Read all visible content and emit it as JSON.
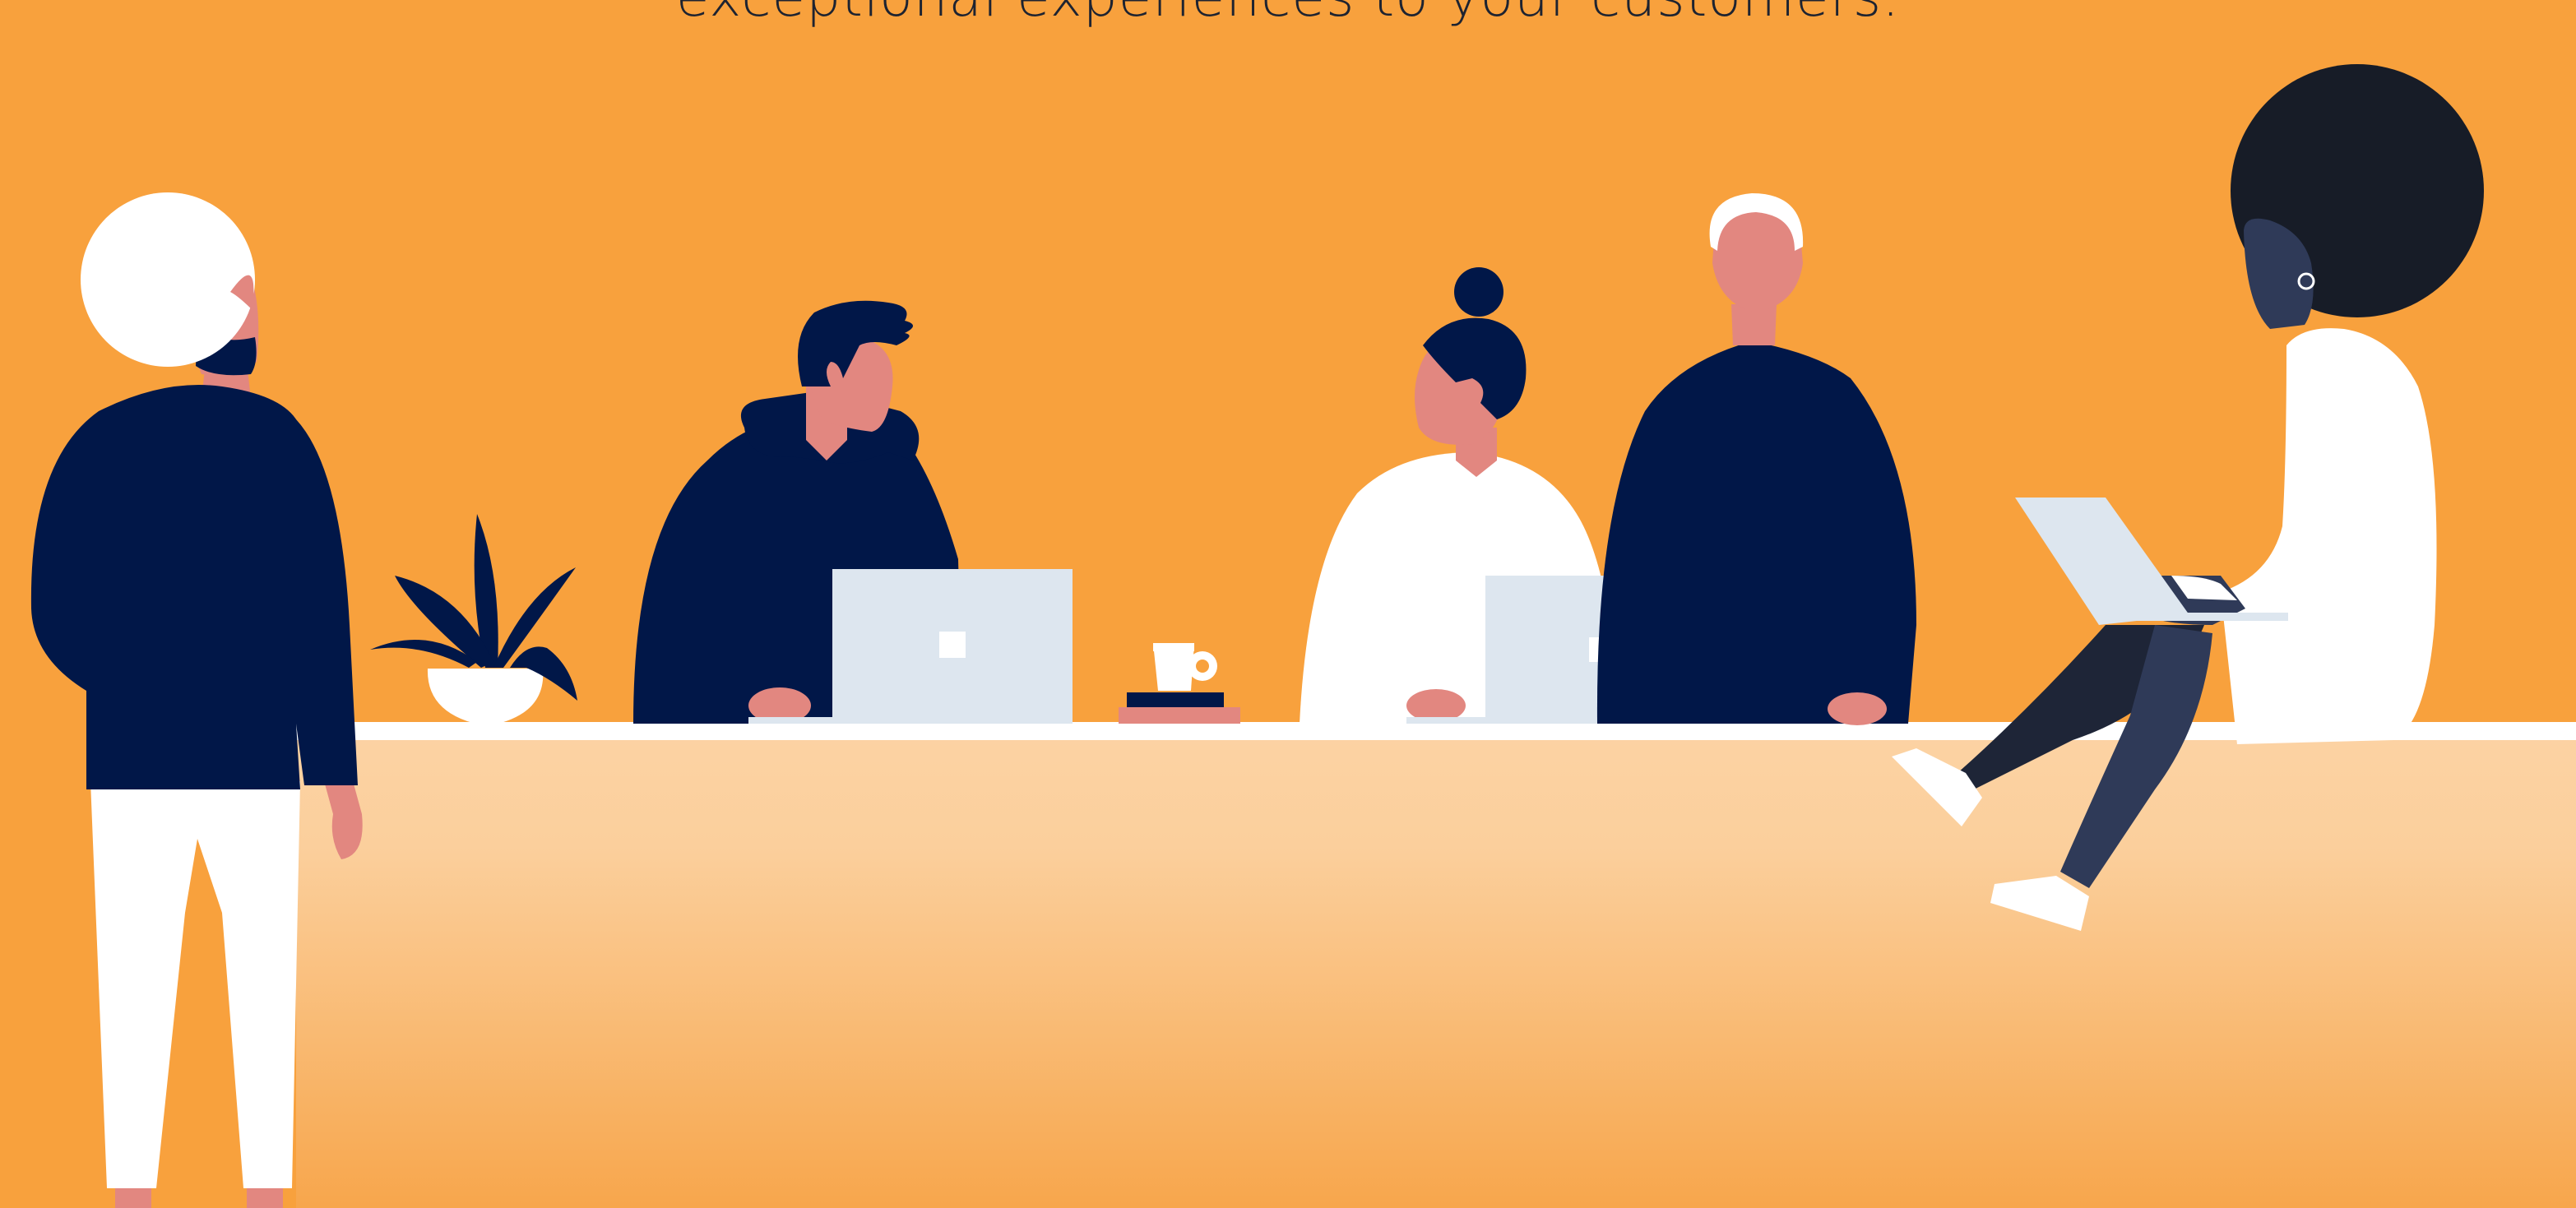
{
  "caption": {
    "text": "exceptional experiences to your customers."
  },
  "colors": {
    "background": "#F8A13D",
    "counter_top": "#FCD3A4",
    "counter_bottom": "#F7A54A",
    "navy": "#011748",
    "skin": "#E28780",
    "white": "#FFFFFF",
    "laptop": "#DDE6EF",
    "dark_hair": "#171C27",
    "dark_skin": "#2F3A58"
  },
  "scene": {
    "icons": [
      "person-turban",
      "person-hoodie",
      "person-bun",
      "person-bald",
      "person-afro-laptop",
      "plant",
      "coffee-cup",
      "book-stack",
      "laptop"
    ]
  }
}
